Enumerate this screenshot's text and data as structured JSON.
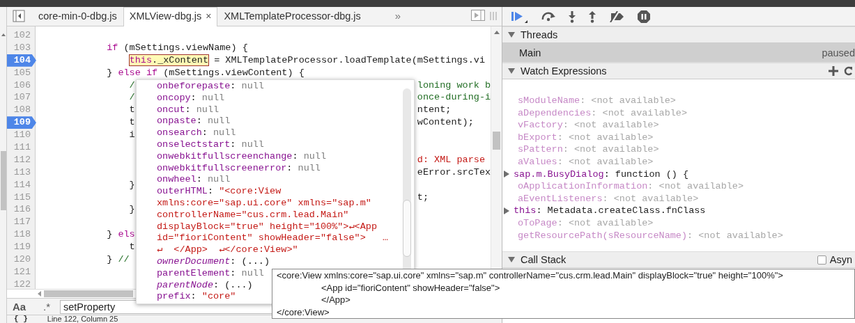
{
  "editor_tabs": [
    {
      "label": "core-min-0-dbg.js",
      "selected": false
    },
    {
      "label": "XMLView-dbg.js",
      "selected": true,
      "close": "×"
    },
    {
      "label": "XMLTemplateProcessor-dbg.js",
      "selected": false
    }
  ],
  "tabs_overflow": "»",
  "code_lines": [
    {
      "number": "102",
      "breakpoint": false
    },
    {
      "number": "103",
      "breakpoint": false,
      "segments": [
        {
          "kind": "keyword",
          "text": "            if"
        },
        {
          "kind": "plain",
          "text": " (mSettings.viewName) {"
        }
      ]
    },
    {
      "number": "104",
      "breakpoint": true,
      "segments": [
        {
          "kind": "highlight",
          "segments": [
            {
              "kind": "keyword",
              "text": "                this"
            },
            {
              "kind": "plain",
              "text": "._xContent"
            }
          ]
        },
        {
          "kind": "plain",
          "text": " = XMLTemplateProcessor.loadTemplate(mSettings.vi"
        }
      ]
    },
    {
      "number": "105",
      "breakpoint": false,
      "segments": [
        {
          "kind": "plain",
          "text": "            } "
        },
        {
          "kind": "keyword",
          "text": "else if"
        },
        {
          "kind": "plain",
          "text": " (mSettings.viewContent) {"
        }
      ]
    },
    {
      "number": "106",
      "breakpoint": false,
      "segments": [
        {
          "kind": "comment",
          "text": "                /"
        }
      ],
      "segments_end": [
        {
          "kind": "comment",
          "text": "loning work b"
        }
      ]
    },
    {
      "number": "107",
      "breakpoint": false,
      "segments": [
        {
          "kind": "comment",
          "text": "                /"
        }
      ],
      "segments_end": [
        {
          "kind": "comment",
          "text": "once-during-i"
        }
      ]
    },
    {
      "number": "108",
      "breakpoint": false,
      "segments": [
        {
          "kind": "plain",
          "text": "                t"
        }
      ],
      "segments_end": [
        {
          "kind": "plain",
          "text": "ntent;"
        }
      ]
    },
    {
      "number": "109",
      "breakpoint": true,
      "segments": [
        {
          "kind": "plain",
          "text": "                t"
        }
      ],
      "segments_end": [
        {
          "kind": "plain",
          "text": "wContent);"
        }
      ]
    },
    {
      "number": "110",
      "breakpoint": false,
      "segments": [
        {
          "kind": "plain",
          "text": "                i"
        }
      ]
    },
    {
      "number": "111",
      "breakpoint": false
    },
    {
      "number": "112",
      "breakpoint": false,
      "segments_end": [
        {
          "kind": "string",
          "text": "d: XML parse"
        }
      ]
    },
    {
      "number": "113",
      "breakpoint": false,
      "segments_end": [
        {
          "kind": "plain",
          "text": "eError.srcTex"
        }
      ]
    },
    {
      "number": "114",
      "breakpoint": false,
      "segments": [
        {
          "kind": "plain",
          "text": "                }"
        }
      ]
    },
    {
      "number": "115",
      "breakpoint": false,
      "segments_end": [
        {
          "kind": "plain",
          "text": "t;"
        }
      ]
    },
    {
      "number": "116",
      "breakpoint": false,
      "segments": [
        {
          "kind": "plain",
          "text": "                }"
        }
      ]
    },
    {
      "number": "117",
      "breakpoint": false
    },
    {
      "number": "118",
      "breakpoint": false,
      "segments": [
        {
          "kind": "plain",
          "text": "            } "
        },
        {
          "kind": "keyword",
          "text": "els"
        }
      ]
    },
    {
      "number": "119",
      "breakpoint": false,
      "segments": [
        {
          "kind": "plain",
          "text": "                t"
        }
      ]
    },
    {
      "number": "120",
      "breakpoint": false,
      "segments": [
        {
          "kind": "plain",
          "text": "            } "
        },
        {
          "kind": "comment",
          "text": "//"
        }
      ]
    },
    {
      "number": "121",
      "breakpoint": false
    },
    {
      "number": "122",
      "breakpoint": false
    }
  ],
  "search_bar": {
    "case_toggle": "Aa",
    "regex_toggle": ".*",
    "value": "setProperty"
  },
  "status_bar": {
    "braces": "{ }",
    "position": "Line 122, Column 25"
  },
  "property_popup": {
    "separator": ": ",
    "properties": [
      {
        "name": "onbeforepaste",
        "value": "null",
        "kind": "null"
      },
      {
        "name": "oncopy",
        "value": "null",
        "kind": "null"
      },
      {
        "name": "oncut",
        "value": "null",
        "kind": "null"
      },
      {
        "name": "onpaste",
        "value": "null",
        "kind": "null"
      },
      {
        "name": "onsearch",
        "value": "null",
        "kind": "null"
      },
      {
        "name": "onselectstart",
        "value": "null",
        "kind": "null"
      },
      {
        "name": "onwebkitfullscreenchange",
        "value": "null",
        "kind": "null"
      },
      {
        "name": "onwebkitfullscreenerror",
        "value": "null",
        "kind": "null"
      },
      {
        "name": "onwheel",
        "value": "null",
        "kind": "null"
      },
      {
        "name": "outerHTML",
        "value": "\"<core:View xmlns:core=\"sap.ui.core\" xmlns=\"sap.m\" controllerName=\"cus.crm.lead.Main\" displayBlock=\"true\" height=\"100%\">↵<App id=\"fioriContent\" showHeader=\"false\">   …  ↵  </App>  ↵</core:View>\"",
        "kind": "string"
      },
      {
        "name": "ownerDocument",
        "value": "(...)",
        "kind": "getter"
      },
      {
        "name": "parentElement",
        "value": "null",
        "kind": "null"
      },
      {
        "name": "parentNode",
        "value": "(...)",
        "kind": "getter"
      },
      {
        "name": "prefix",
        "value": "\"core\"",
        "kind": "string"
      }
    ]
  },
  "tooltip_lines": [
    "<core:View xmlns:core=\"sap.ui.core\" xmlns=\"sap.m\" controllerName=\"cus.crm.lead.Main\" displayBlock=\"true\" height=\"100%\">",
    "\t<App id=\"fioriContent\" showHeader=\"false\">",
    "\t</App>",
    "</core:View>"
  ],
  "threads": {
    "title": "Threads",
    "expanded": true,
    "items": [
      {
        "name": "Main",
        "status": "paused",
        "selected": true
      }
    ]
  },
  "watch_expressions": {
    "title": "Watch Expressions",
    "expanded": true,
    "separator": ": ",
    "items": [
      {
        "name": "sModuleName",
        "value": "<not available>",
        "kind": "unavailable"
      },
      {
        "name": "aDependencies",
        "value": "<not available>",
        "kind": "unavailable"
      },
      {
        "name": "vFactory",
        "value": "<not available>",
        "kind": "unavailable"
      },
      {
        "name": "bExport",
        "value": "<not available>",
        "kind": "unavailable"
      },
      {
        "name": "sPattern",
        "value": "<not available>",
        "kind": "unavailable"
      },
      {
        "name": "aValues",
        "value": "<not available>",
        "kind": "unavailable"
      },
      {
        "name": "sap.m.BusyDialog",
        "value": "function () {",
        "kind": "object",
        "expanded": false
      },
      {
        "name": "oApplicationInformation",
        "value": "<not available>",
        "kind": "unavailable"
      },
      {
        "name": "aEventListeners",
        "value": "<not available>",
        "kind": "unavailable"
      },
      {
        "name": "this",
        "value": "Metadata.createClass.fnClass",
        "kind": "object",
        "expanded": false
      },
      {
        "name": "oToPage",
        "value": "<not available>",
        "kind": "unavailable"
      },
      {
        "name": "getResourcePath(sResourceName)",
        "value": "<not available>",
        "kind": "unavailable"
      }
    ]
  },
  "call_stack": {
    "title": "Call Stack",
    "expanded": true,
    "async_label": "Asyn",
    "async_checked": false
  }
}
